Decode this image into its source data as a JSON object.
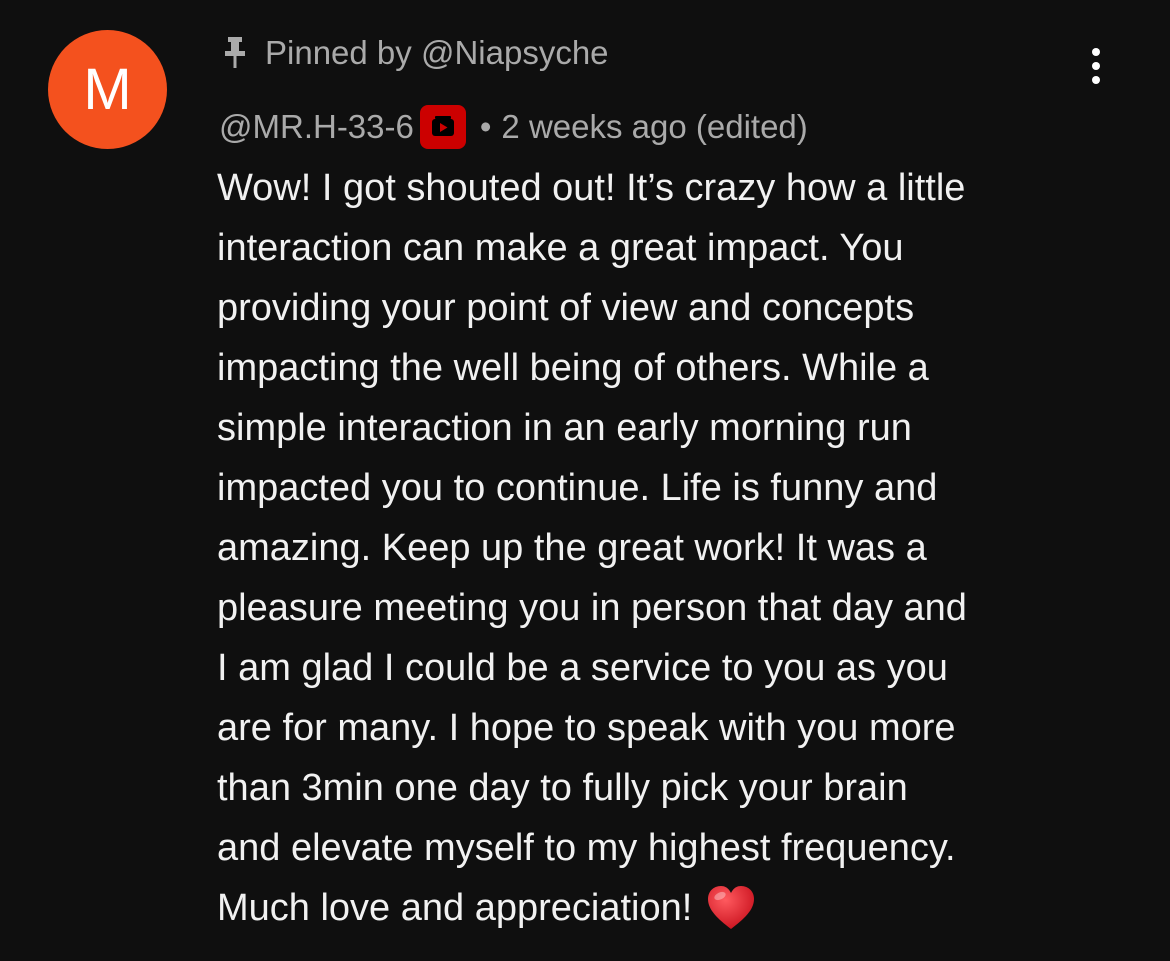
{
  "comment": {
    "avatar_initial": "M",
    "avatar_color": "#f4511e",
    "pinned_text": "Pinned by @Niapsyche",
    "pin_icon": "pin-icon",
    "author_handle": "@MR.H-33-6",
    "member_badge_icon": "member-badge-icon",
    "member_badge_color": "#cc0000",
    "separator": "•",
    "timestamp": "2 weeks ago (edited)",
    "menu_icon": "more-vertical-icon",
    "body_lines": [
      "Wow! I got shouted out! It’s crazy how a little",
      "interaction can make a great impact. You",
      "providing your point of view and concepts",
      "impacting the well being of others. While a",
      "simple interaction in an early morning run",
      "impacted you to continue. Life is funny and",
      "amazing. Keep up the great work! It was a",
      "pleasure meeting you in person that day and",
      "I am glad I could be a service to you as you",
      "are for many. I hope to speak with you more",
      "than 3min one day to fully pick your brain",
      "and elevate myself to my highest frequency.",
      "Much love and appreciation!"
    ],
    "trailing_emoji": "heart-emoji-icon",
    "heart_color": "#e0121f"
  }
}
